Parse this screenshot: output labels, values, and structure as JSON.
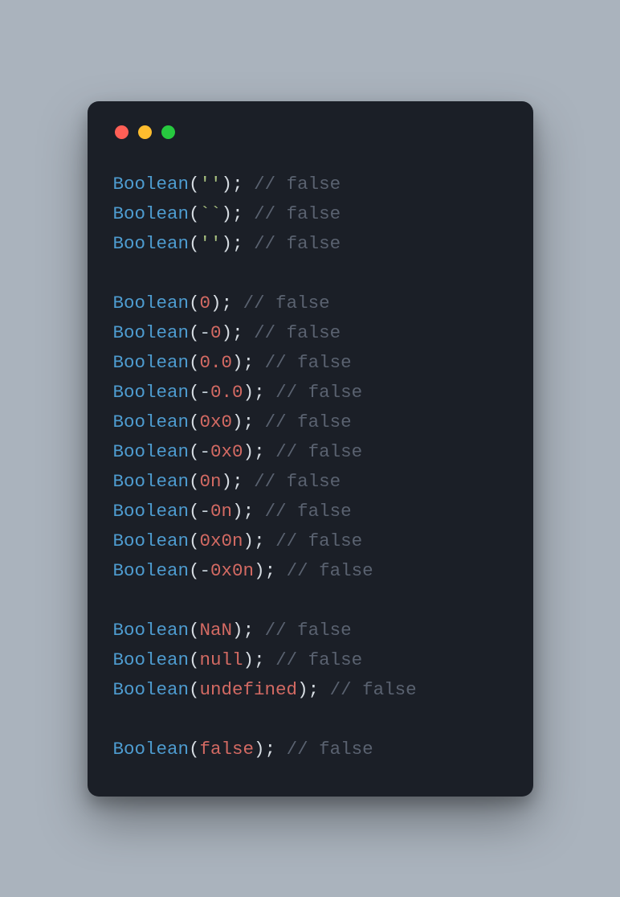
{
  "fn": "Boolean",
  "paren_open": "(",
  "paren_close": ")",
  "semi": ";",
  "neg": "-",
  "comment_prefix": "// ",
  "comment_value": "false",
  "lines": [
    {
      "arg_type": "string",
      "arg": "''"
    },
    {
      "arg_type": "string",
      "arg": "``"
    },
    {
      "arg_type": "string",
      "arg": "''"
    },
    {
      "blank": true
    },
    {
      "arg_type": "number",
      "arg": "0"
    },
    {
      "arg_type": "number",
      "neg": true,
      "arg": "0"
    },
    {
      "arg_type": "number",
      "arg": "0.0"
    },
    {
      "arg_type": "number",
      "neg": true,
      "arg": "0.0"
    },
    {
      "arg_type": "number",
      "arg": "0x0"
    },
    {
      "arg_type": "number",
      "neg": true,
      "arg": "0x0"
    },
    {
      "arg_type": "number",
      "arg": "0n"
    },
    {
      "arg_type": "number",
      "neg": true,
      "arg": "0n"
    },
    {
      "arg_type": "number",
      "arg": "0x0n"
    },
    {
      "arg_type": "number",
      "neg": true,
      "arg": "0x0n"
    },
    {
      "blank": true
    },
    {
      "arg_type": "identifier",
      "arg": "NaN"
    },
    {
      "arg_type": "identifier",
      "arg": "null"
    },
    {
      "arg_type": "identifier",
      "arg": "undefined"
    },
    {
      "blank": true
    },
    {
      "arg_type": "identifier",
      "arg": "false"
    }
  ]
}
